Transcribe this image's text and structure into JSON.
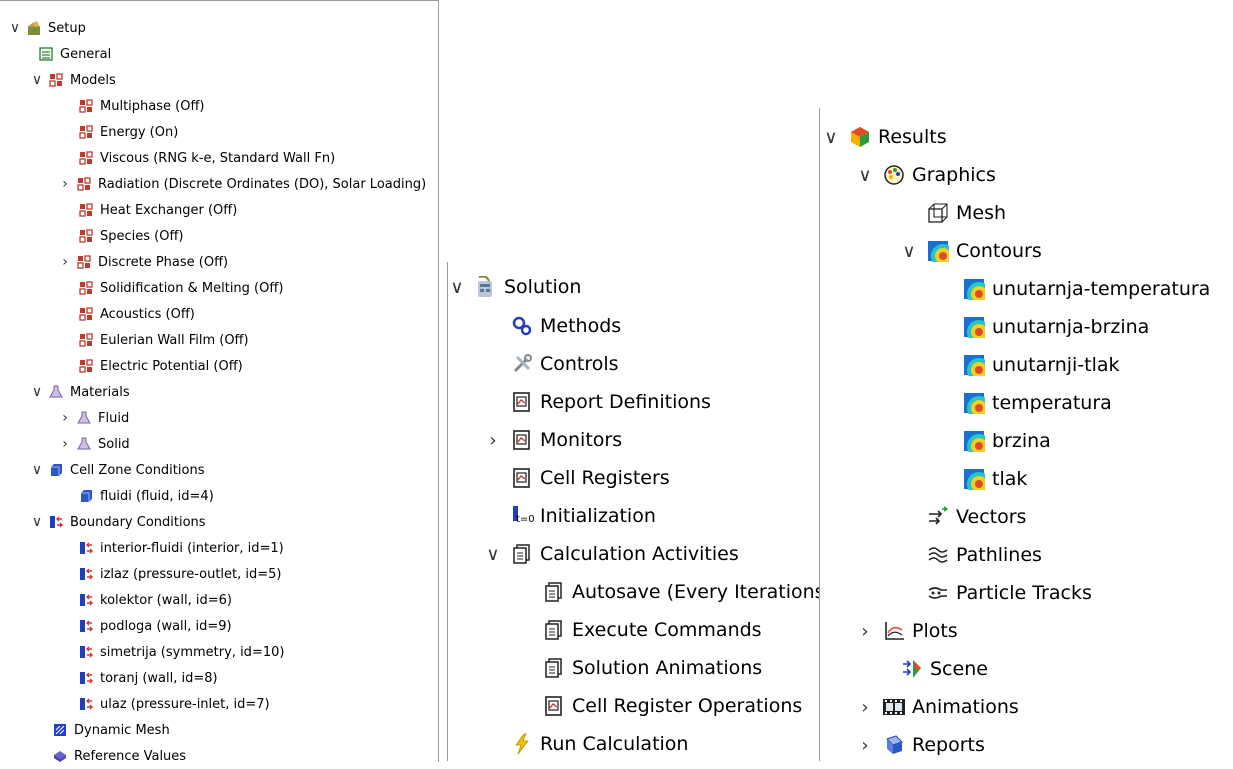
{
  "setup": {
    "root": "Setup",
    "general": "General",
    "models": {
      "label": "Models",
      "items": [
        "Multiphase (Off)",
        "Energy (On)",
        "Viscous (RNG k-e, Standard Wall Fn)",
        "Radiation (Discrete Ordinates (DO), Solar Loading)",
        "Heat Exchanger (Off)",
        "Species (Off)",
        "Discrete Phase (Off)",
        "Solidification & Melting (Off)",
        "Acoustics (Off)",
        "Eulerian Wall Film (Off)",
        "Electric Potential (Off)"
      ]
    },
    "materials": {
      "label": "Materials",
      "items": [
        "Fluid",
        "Solid"
      ]
    },
    "cell_zone": {
      "label": "Cell Zone Conditions",
      "items": [
        "fluidi (fluid, id=4)"
      ]
    },
    "boundary": {
      "label": "Boundary Conditions",
      "items": [
        "interior-fluidi (interior, id=1)",
        "izlaz (pressure-outlet, id=5)",
        "kolektor (wall, id=6)",
        "podloga (wall, id=9)",
        "simetrija (symmetry, id=10)",
        "toranj (wall, id=8)",
        "ulaz (pressure-inlet, id=7)"
      ]
    },
    "dynamic_mesh": "Dynamic Mesh",
    "reference_values": "Reference Values"
  },
  "solution": {
    "root": "Solution",
    "methods": "Methods",
    "controls": "Controls",
    "report_definitions": "Report Definitions",
    "monitors": "Monitors",
    "cell_registers": "Cell Registers",
    "initialization": "Initialization",
    "initialization_icon_text": "t=0",
    "calc_activities": {
      "label": "Calculation Activities",
      "items": [
        "Autosave (Every Iterations)",
        "Execute Commands",
        "Solution Animations",
        "Cell Register Operations"
      ]
    },
    "run_calculation": "Run Calculation"
  },
  "results": {
    "root": "Results",
    "graphics": "Graphics",
    "mesh": "Mesh",
    "contours": {
      "label": "Contours",
      "items": [
        "unutarnja-temperatura",
        "unutarnja-brzina",
        "unutarnji-tlak",
        "temperatura",
        "brzina",
        "tlak"
      ]
    },
    "vectors": "Vectors",
    "pathlines": "Pathlines",
    "particle_tracks": "Particle Tracks",
    "plots": "Plots",
    "scene": "Scene",
    "animations": "Animations",
    "reports": "Reports"
  },
  "glyphs": {
    "expanded": "∨",
    "collapsed": "›"
  },
  "colors": {
    "models_icon": "#c0392b",
    "boundary_icon": "#1f3fbf",
    "materials_icon": "#7a5fb0",
    "contour_bg": "#1a6fd1",
    "run_icon": "#f2c200"
  }
}
